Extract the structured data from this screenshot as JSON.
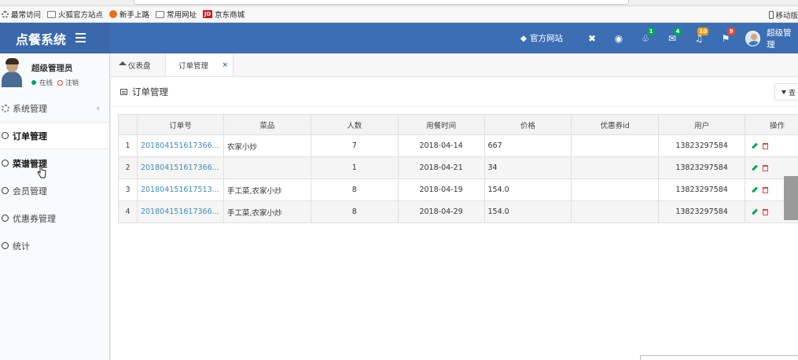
{
  "browser": {
    "bookmarks": [
      "最常访问",
      "火狐官方站点",
      "新手上路",
      "常用网址",
      "京东商城"
    ],
    "bookmark_right": "移动版"
  },
  "header": {
    "logo": "点餐系统",
    "official_site": "官方网站",
    "badges": {
      "bell_user": "1",
      "mail": "4",
      "bell": "10",
      "flag": "9"
    },
    "user_name": "超级管理"
  },
  "sidebar": {
    "user_name": "超级管理员",
    "online": "在线",
    "logout": "注销",
    "menu_title": "系统管理",
    "items": [
      {
        "label": "订单管理"
      },
      {
        "label": "菜谱管理"
      },
      {
        "label": "会员管理"
      },
      {
        "label": "优惠券管理"
      },
      {
        "label": "统计"
      }
    ]
  },
  "tabs": {
    "dashboard": "仪表盘",
    "orders": "订单管理",
    "close": "×"
  },
  "panel": {
    "title": "订单管理",
    "query_button": "查"
  },
  "table": {
    "headers": [
      "订单号",
      "菜品",
      "人数",
      "用餐时间",
      "价格",
      "优惠券id",
      "用户",
      "操作"
    ],
    "rows": [
      {
        "idx": "1",
        "order": "201804151617366...",
        "dish": "农家小炒",
        "people": "7",
        "time": "2018-04-14",
        "price": "667",
        "coupon": "",
        "user": "13823297584"
      },
      {
        "idx": "2",
        "order": "201804151617366...",
        "dish": "",
        "people": "1",
        "time": "2018-04-21",
        "price": "34",
        "coupon": "",
        "user": "13823297584"
      },
      {
        "idx": "3",
        "order": "201804151617513...",
        "dish": "手工菜,农家小炒",
        "people": "8",
        "time": "2018-04-19",
        "price": "154.0",
        "coupon": "",
        "user": "13823297584"
      },
      {
        "idx": "4",
        "order": "201804151617366...",
        "dish": "手工菜,农家小炒",
        "people": "8",
        "time": "2018-04-29",
        "price": "154.0",
        "coupon": "",
        "user": "13823297584"
      }
    ]
  },
  "colors": {
    "header": "#3c6eb4",
    "logo_bg": "#3968ab",
    "link": "#3c8dbc",
    "edit": "#00a65a",
    "delete": "#dd4b39"
  }
}
